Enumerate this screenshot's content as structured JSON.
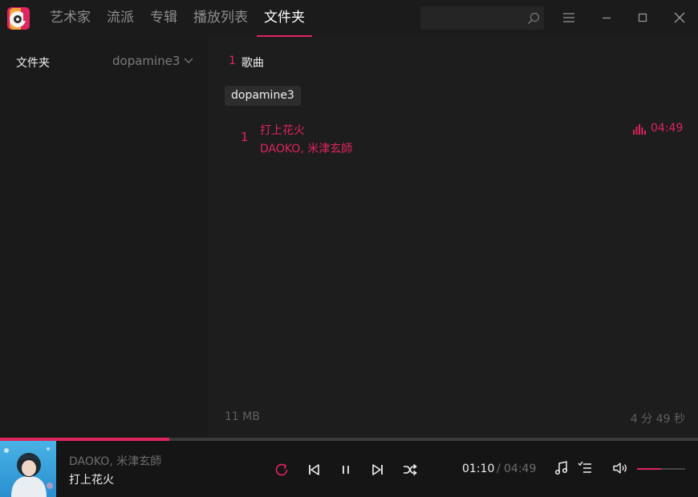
{
  "nav": {
    "tabs": [
      {
        "label": "艺术家"
      },
      {
        "label": "流派"
      },
      {
        "label": "专辑"
      },
      {
        "label": "播放列表"
      },
      {
        "label": "文件夹",
        "active": true
      }
    ]
  },
  "search": {
    "value": "",
    "icon": "search-icon"
  },
  "window_controls": [
    "menu-icon",
    "minimize-icon",
    "maximize-icon",
    "close-icon"
  ],
  "sidebar": {
    "title": "文件夹",
    "selected_folder": "dopamine3"
  },
  "main": {
    "song_count": "1",
    "song_count_label": "歌曲",
    "folder_chip": "dopamine3",
    "songs": [
      {
        "index": "1",
        "title": "打上花火",
        "artist": "DAOKO, 米津玄師",
        "duration": "04:49",
        "playing": true
      }
    ],
    "footer_size": "11 MB",
    "footer_duration": "4 分 49 秒"
  },
  "player": {
    "artist": "DAOKO, 米津玄師",
    "title": "打上花火",
    "time_current": "01:10",
    "time_separator": "/",
    "time_total": "04:49",
    "progress_fraction": 0.242,
    "volume_fraction": 0.5
  },
  "colors": {
    "accent": "#e0245e",
    "background": "#1d1d1d",
    "sidebar": "#1a1a1a",
    "player": "#151515"
  }
}
